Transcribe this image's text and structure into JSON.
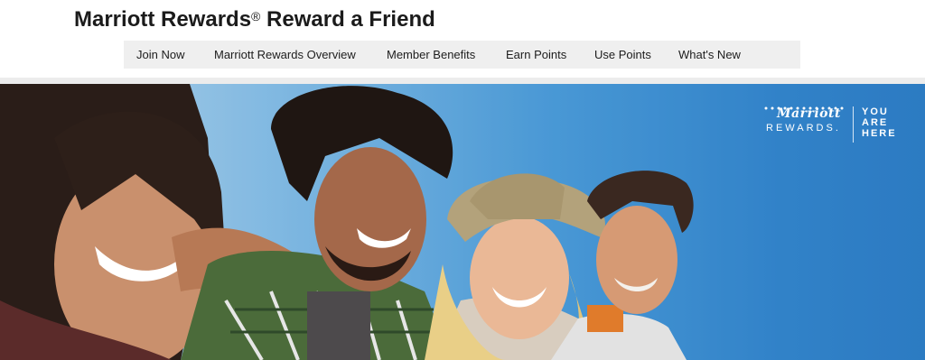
{
  "header": {
    "title_main": "Marriott Rewards",
    "title_mark": "®",
    "title_rest": " Reward a Friend"
  },
  "nav": {
    "items": [
      {
        "label": "Join Now"
      },
      {
        "label": "Marriott Rewards Overview"
      },
      {
        "label": "Member Benefits"
      },
      {
        "label": "Earn Points"
      },
      {
        "label": "Use Points"
      },
      {
        "label": "What's New"
      }
    ]
  },
  "hero": {
    "brand_name": "Marriott",
    "brand_sub": "REWARDS.",
    "tagline": [
      "YOU",
      "ARE",
      "HERE"
    ],
    "image_alt": "Four smiling friends on a beach",
    "colors": {
      "sky": "#4b9ad6",
      "sky_deep": "#2a78c0"
    }
  }
}
